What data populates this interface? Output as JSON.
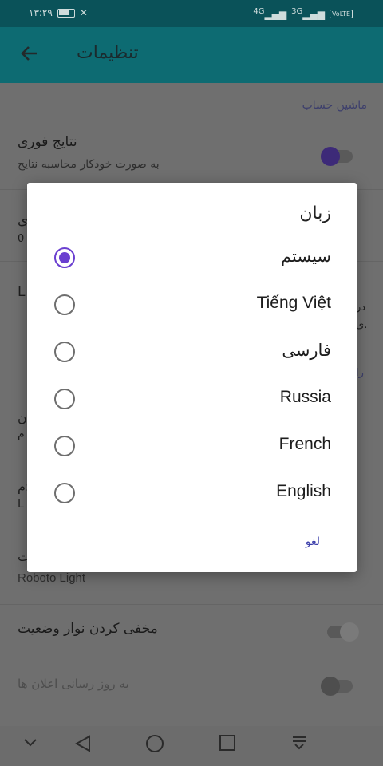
{
  "status_bar": {
    "time": "۱۳:۲۹",
    "network_badge": "VoLTE",
    "net1": "4G",
    "net2": "3G"
  },
  "toolbar": {
    "title": "تنظیمات",
    "back_icon": "arrow-left-icon"
  },
  "settings": {
    "section_header": "ماشین حساب",
    "instant_results": {
      "title": "نتایج فوری",
      "subtitle": "به صورت خودکار محاسبه نتایج"
    },
    "row2": {
      "partial_title": "ی",
      "partial_sub": "0"
    },
    "row3": {
      "partial_left": "L",
      "partial_right_1": "در",
      "partial_right_2": "ی.",
      "partial_right_3": "را"
    },
    "row4": {
      "partial_title": "ن",
      "partial_sub": "م"
    },
    "row5": {
      "partial_title": "م:",
      "partial_sub": "L"
    },
    "row6": {
      "partial_title": "ت",
      "subtitle": "Roboto Light"
    },
    "hide_status_bar": {
      "title": "مخفی کردن نوار وضعیت"
    },
    "notifications": {
      "title": "به روز رسانی اعلان ها"
    }
  },
  "dialog": {
    "title": "زبان",
    "options": [
      {
        "label": "سیستم",
        "selected": true
      },
      {
        "label": "Tiếng Việt",
        "selected": false
      },
      {
        "label": "فارسی",
        "selected": false
      },
      {
        "label": "Russia",
        "selected": false
      },
      {
        "label": "French",
        "selected": false
      },
      {
        "label": "English",
        "selected": false
      }
    ],
    "cancel_label": "لغو"
  },
  "colors": {
    "accent": "#6a3fd0",
    "toolbar": "#0d6b72",
    "statusbar": "#0a5259"
  },
  "navbar": {
    "icons": [
      "chevron-down-icon",
      "back-triangle-icon",
      "home-circle-icon",
      "recents-square-icon",
      "notification-drawer-icon"
    ]
  }
}
